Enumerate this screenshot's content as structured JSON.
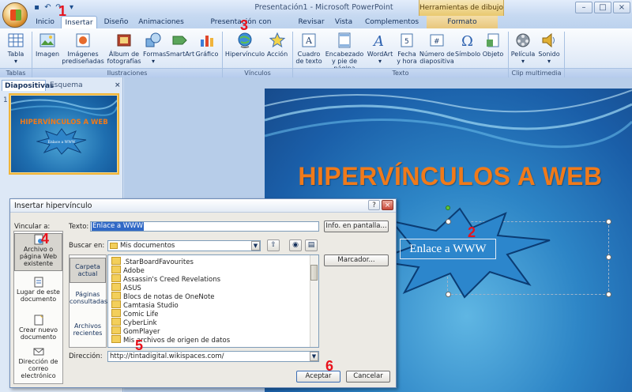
{
  "titlebar": {
    "title": "Presentación1 - Microsoft PowerPoint",
    "contextual": "Herramientas de dibujo",
    "qat": [
      "save-icon",
      "undo-icon",
      "redo-icon",
      "customize-icon"
    ]
  },
  "tabs": [
    "Inicio",
    "Insertar",
    "Diseño",
    "Animaciones",
    "Presentación con diapositivas",
    "Revisar",
    "Vista",
    "Complementos",
    "Formato"
  ],
  "ribbon": {
    "buttons": {
      "tabla": "Tabla",
      "imagen": "Imagen",
      "imagenes_pred": "Imágenes prediseñadas",
      "album": "Álbum de fotografías",
      "formas": "Formas",
      "smartart": "SmartArt",
      "grafico": "Gráfico",
      "hipervinculo": "Hipervínculo",
      "accion": "Acción",
      "cuadro_texto": "Cuadro de texto",
      "encabezado": "Encabezado y pie de página",
      "wordart": "WordArt",
      "fecha": "Fecha y hora",
      "numero_diap": "Número de diapositiva",
      "simbolo": "Símbolo",
      "objeto": "Objeto",
      "pelicula": "Película",
      "sonido": "Sonido"
    },
    "groups": {
      "tablas": "Tablas",
      "ilustraciones": "Ilustraciones",
      "vinculos": "Vínculos",
      "texto": "Texto",
      "clip": "Clip multimedia"
    }
  },
  "panel": {
    "tab_slides": "Diapositivas",
    "tab_outline": "Esquema",
    "close": "×",
    "slide_number": "1",
    "thumb_title": "HIPERVÍNCULOS A WEB",
    "thumb_star_text": "Enlace a WWW"
  },
  "slide": {
    "title": "HIPERVÍNCULOS A WEB",
    "star_text": "Enlace a WWW"
  },
  "callouts": [
    "1",
    "2",
    "3",
    "4",
    "5",
    "6"
  ],
  "dialog": {
    "title": "Insertar hipervínculo",
    "link_to_label": "Vincular a:",
    "link_to": [
      "Archivo o página Web existente",
      "Lugar de este documento",
      "Crear nuevo documento",
      "Dirección de correo electrónico"
    ],
    "text_label": "Texto:",
    "text_value": "Enlace a WWW",
    "screen_tip": "Info. en pantalla...",
    "look_in_label": "Buscar en:",
    "look_in_value": "Mis documentos",
    "bookmark": "Marcador...",
    "side_tabs": [
      "Carpeta actual",
      "Páginas consultadas",
      "Archivos recientes"
    ],
    "files": [
      ".StarBoardFavourites",
      "Adobe",
      "Assassin's Creed Revelations",
      "ASUS",
      "Blocs de notas de OneNote",
      "Camtasia Studio",
      "Comic Life",
      "CyberLink",
      "GomPlayer",
      "Mis archivos de origen de datos"
    ],
    "address_label": "Dirección:",
    "address_value": "http://tintadigital.wikispaces.com/",
    "ok": "Aceptar",
    "cancel": "Cancelar"
  },
  "colors": {
    "accent_orange": "#f07a1a",
    "slide_blue": "#1a5ea8",
    "callout_red": "#e8121c"
  }
}
